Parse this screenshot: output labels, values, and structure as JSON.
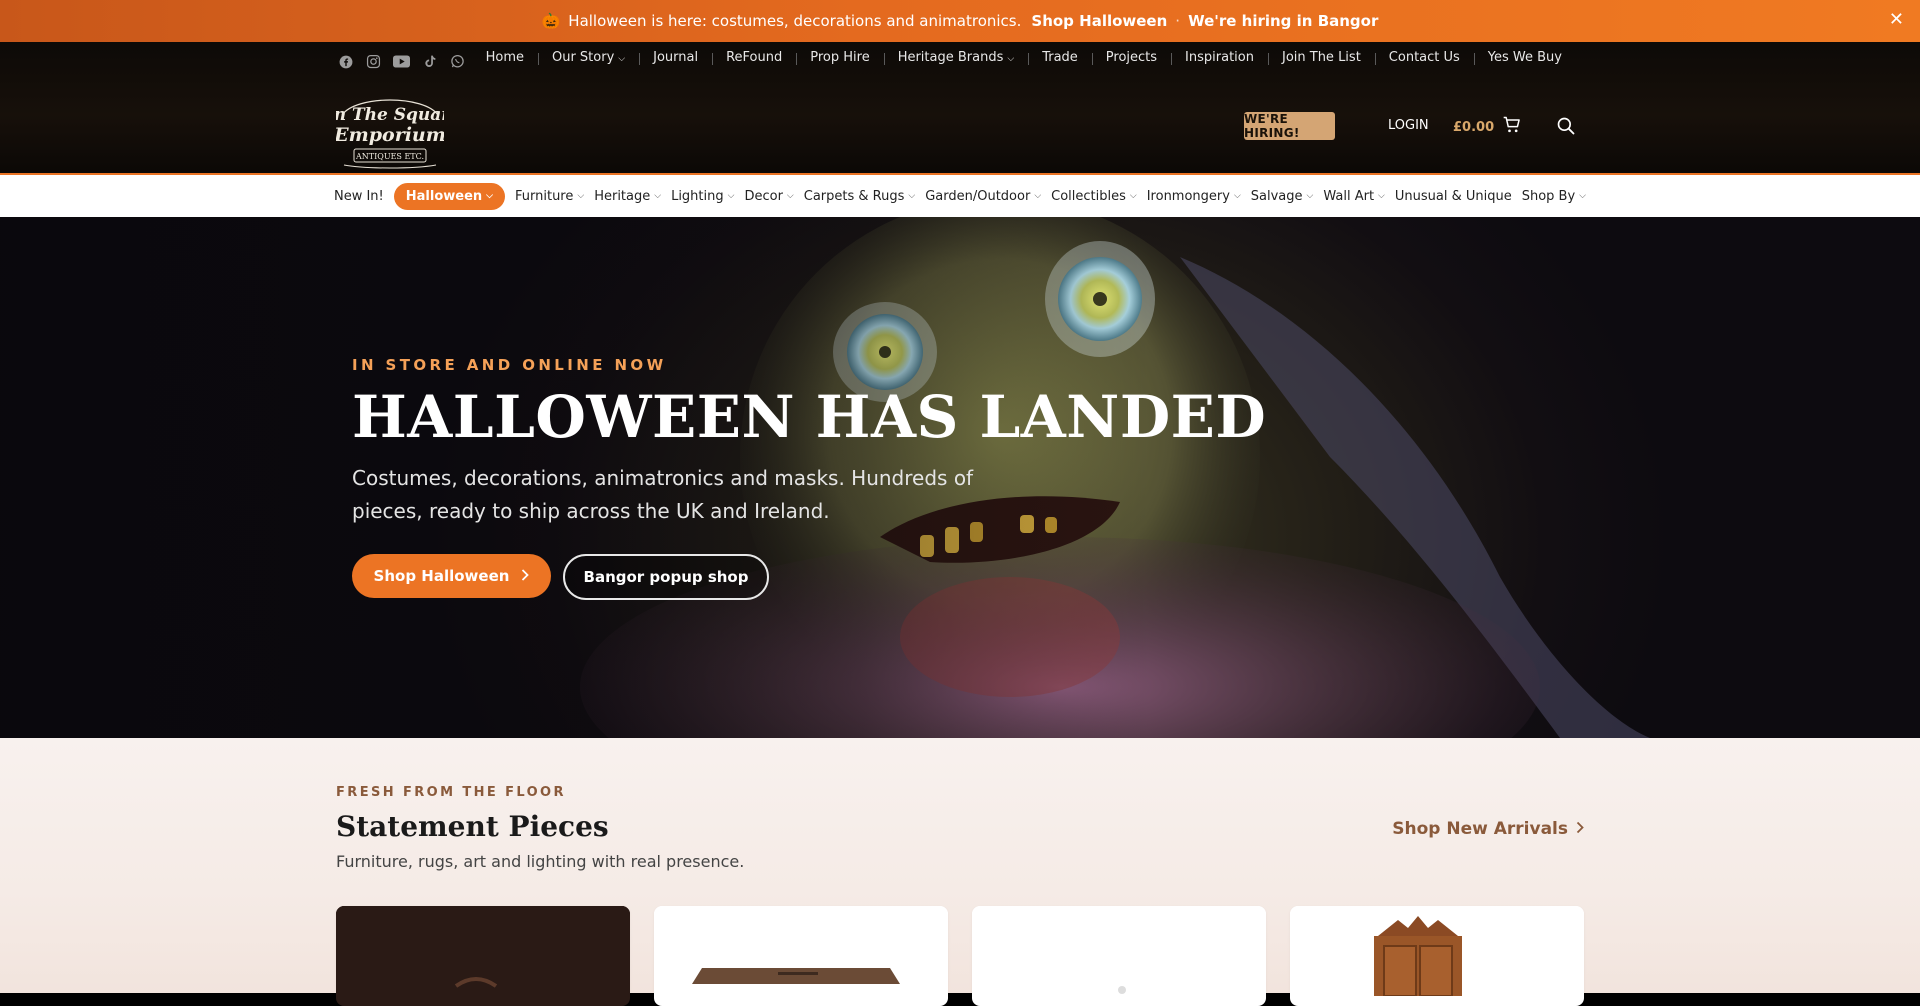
{
  "announcement": {
    "icon": "pumpkin-icon",
    "message": "Halloween is here: costumes, decorations and animatronics.",
    "link_halloween": "Shop Halloween",
    "separator": "·",
    "link_hiring": "We're hiring in Bangor",
    "close_label": "✕"
  },
  "social": [
    "facebook-icon",
    "instagram-icon",
    "youtube-icon",
    "tiktok-icon",
    "whatsapp-icon"
  ],
  "topnav": {
    "items": [
      {
        "label": "Home",
        "dropdown": false
      },
      {
        "label": "Our Story",
        "dropdown": true
      },
      {
        "label": "Journal",
        "dropdown": false
      },
      {
        "label": "ReFound",
        "dropdown": false
      },
      {
        "label": "Prop Hire",
        "dropdown": false
      },
      {
        "label": "Heritage Brands",
        "dropdown": true
      },
      {
        "label": "Trade",
        "dropdown": false
      },
      {
        "label": "Projects",
        "dropdown": false
      },
      {
        "label": "Inspiration",
        "dropdown": false
      },
      {
        "label": "Join The List",
        "dropdown": false
      },
      {
        "label": "Contact Us",
        "dropdown": false
      },
      {
        "label": "Yes We Buy",
        "dropdown": false
      }
    ]
  },
  "logo": {
    "line1": "On The Square",
    "line2": "Emporium",
    "line3": "ANTIQUES ETC."
  },
  "header": {
    "hiring_label": "WE'RE HIRING!",
    "login_label": "LOGIN",
    "cart_total": "£0.00"
  },
  "catnav": {
    "items": [
      {
        "label": "New In!",
        "dropdown": false,
        "active": false
      },
      {
        "label": "Halloween",
        "dropdown": true,
        "active": true
      },
      {
        "label": "Furniture",
        "dropdown": true,
        "active": false
      },
      {
        "label": "Heritage",
        "dropdown": true,
        "active": false
      },
      {
        "label": "Lighting",
        "dropdown": true,
        "active": false
      },
      {
        "label": "Decor",
        "dropdown": true,
        "active": false
      },
      {
        "label": "Carpets & Rugs",
        "dropdown": true,
        "active": false
      },
      {
        "label": "Garden/Outdoor",
        "dropdown": true,
        "active": false
      },
      {
        "label": "Collectibles",
        "dropdown": true,
        "active": false
      },
      {
        "label": "Ironmongery",
        "dropdown": true,
        "active": false
      },
      {
        "label": "Salvage",
        "dropdown": true,
        "active": false
      },
      {
        "label": "Wall Art",
        "dropdown": true,
        "active": false
      },
      {
        "label": "Unusual & Unique",
        "dropdown": false,
        "active": false
      },
      {
        "label": "Shop By",
        "dropdown": true,
        "active": false
      }
    ]
  },
  "hero": {
    "eyebrow": "IN STORE AND ONLINE NOW",
    "title": "HALLOWEEN HAS LANDED",
    "subtitle": "Costumes, decorations, animatronics and masks. Hundreds of pieces, ready to ship across the UK and Ireland.",
    "primary_button": "Shop Halloween",
    "secondary_button": "Bangor popup shop"
  },
  "section": {
    "kicker": "FRESH FROM THE FLOOR",
    "title": "Statement Pieces",
    "description": "Furniture, rugs, art and lighting with real presence.",
    "link": "Shop New Arrivals"
  },
  "colors": {
    "accent": "#ec7424",
    "hiring_button": "#d4a574",
    "link_brown": "#8a5a3b",
    "header_bg": "#0d0a07"
  }
}
